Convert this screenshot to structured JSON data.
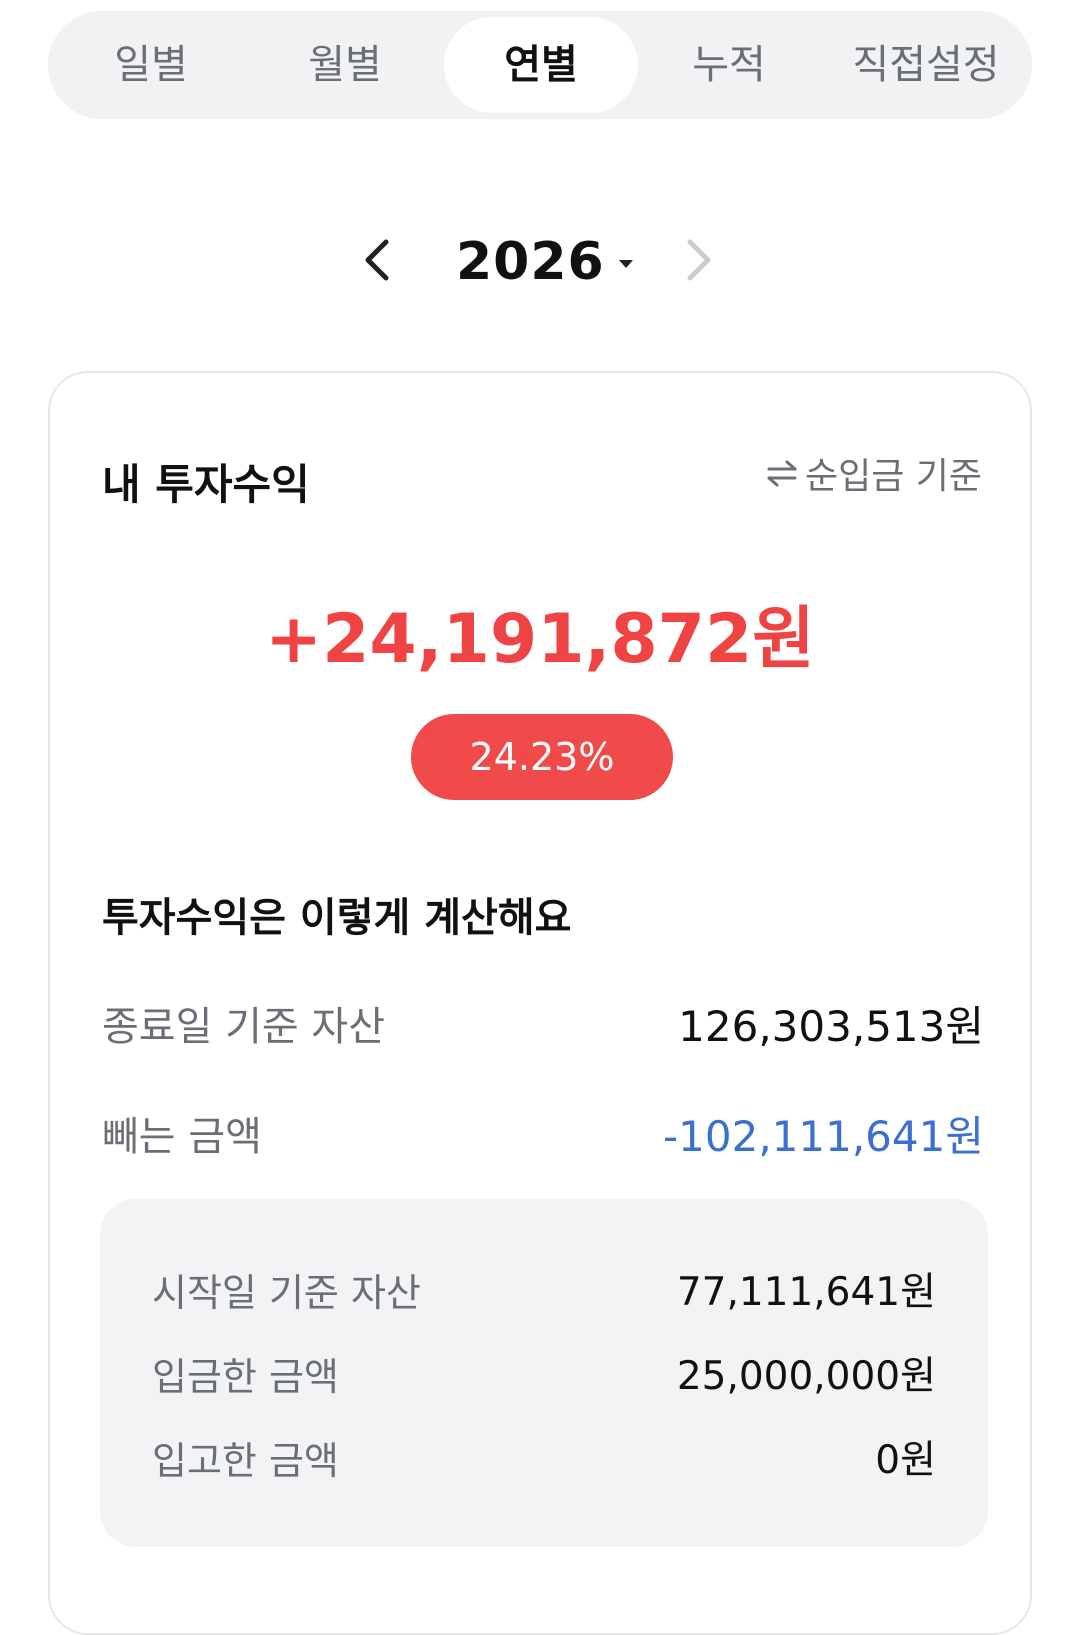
{
  "tabs": [
    {
      "label": "일별",
      "active": false
    },
    {
      "label": "월별",
      "active": false
    },
    {
      "label": "연별",
      "active": true
    },
    {
      "label": "누적",
      "active": false
    },
    {
      "label": "직접설정",
      "active": false
    }
  ],
  "year_nav": {
    "year": "2026",
    "prev_icon": "chevron-left-icon",
    "next_icon": "chevron-right-icon",
    "dropdown_icon": "caret-down-icon"
  },
  "summary": {
    "title": "내 투자수익",
    "basis_toggle": {
      "label": "순입금 기준",
      "icon": "swap-arrows-icon"
    },
    "profit_amount": "+24,191,872원",
    "profit_rate": "24.23%"
  },
  "calculation": {
    "title": "투자수익은 이렇게 계산해요",
    "end_assets": {
      "label": "종료일 기준 자산",
      "value": "126,303,513원"
    },
    "deduction": {
      "label": "빼는 금액",
      "value": "-102,111,641원"
    },
    "breakdown": [
      {
        "label": "시작일 기준 자산",
        "value": "77,111,641원"
      },
      {
        "label": "입금한 금액",
        "value": "25,000,000원"
      },
      {
        "label": "입고한 금액",
        "value": "0원"
      }
    ]
  },
  "colors": {
    "profit_red": "#ef4444",
    "badge_red": "#f04a4a",
    "minus_blue": "#3b6fd1",
    "tab_bg": "#f1f2f3",
    "breakdown_bg": "#f2f3f4"
  }
}
